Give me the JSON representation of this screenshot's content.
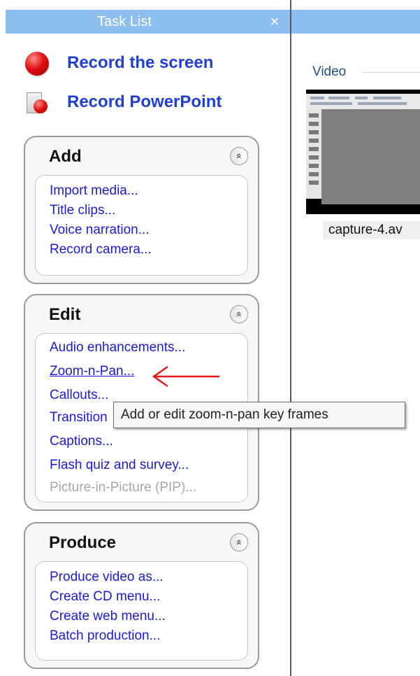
{
  "task_pane": {
    "title": "Task List",
    "close_glyph": "×",
    "record_screen_label": "Record the screen",
    "record_powerpoint_label": "Record PowerPoint"
  },
  "groups": {
    "add": {
      "title": "Add",
      "collapse_glyph": "«",
      "links": [
        "Import media...",
        "Title clips...",
        "Voice narration...",
        "Record camera..."
      ]
    },
    "edit": {
      "title": "Edit",
      "collapse_glyph": "«",
      "links": [
        "Audio enhancements...",
        "Zoom-n-Pan...",
        "Callouts...",
        "Transition",
        "Captions...",
        "Flash quiz and survey...",
        "Picture-in-Picture (PIP)..."
      ]
    },
    "produce": {
      "title": "Produce",
      "collapse_glyph": "«",
      "links": [
        "Produce video as...",
        "Create CD menu...",
        "Create web menu...",
        "Batch production..."
      ]
    }
  },
  "tooltip": {
    "text": "Add or edit zoom-n-pan key frames"
  },
  "clip_bin": {
    "section_label": "Video",
    "clip_name": "capture-4.av"
  },
  "colors": {
    "header_blue": "#8ebdf0",
    "link_blue": "#1a1adb",
    "record_red": "#e01010",
    "arrow_red": "#e21b1b"
  },
  "icons": [
    "record-screen-icon",
    "record-powerpoint-icon",
    "collapse-icon",
    "close-icon",
    "arrow-annotation"
  ]
}
